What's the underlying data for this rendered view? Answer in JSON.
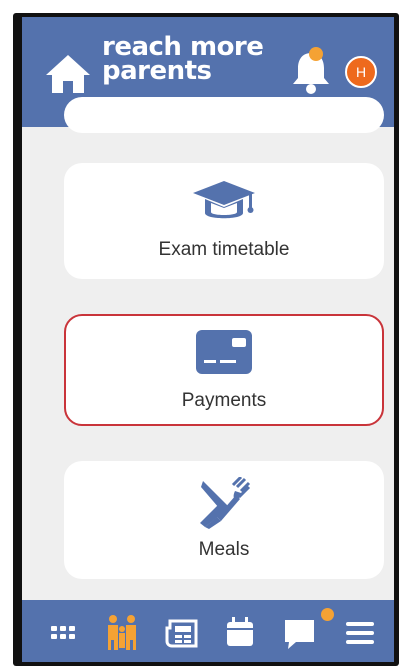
{
  "header": {
    "brand_line1": "reach more",
    "brand_line2": "parents",
    "avatar_initial": "H"
  },
  "menu": [
    {
      "label": "Exam timetable",
      "icon": "graduation-cap-icon"
    },
    {
      "label": "Payments",
      "icon": "credit-card-icon",
      "selected": true
    },
    {
      "label": "Meals",
      "icon": "fork-knife-icon"
    }
  ],
  "bottom_nav": [
    "grid-icon",
    "family-icon",
    "newspaper-icon",
    "calendar-icon",
    "chat-icon",
    "hamburger-menu-icon"
  ],
  "colors": {
    "header_bg": "#5472ad",
    "accent_orange": "#f5a234",
    "selected_border": "#c9343a",
    "avatar_bg": "#ee6a1d"
  }
}
